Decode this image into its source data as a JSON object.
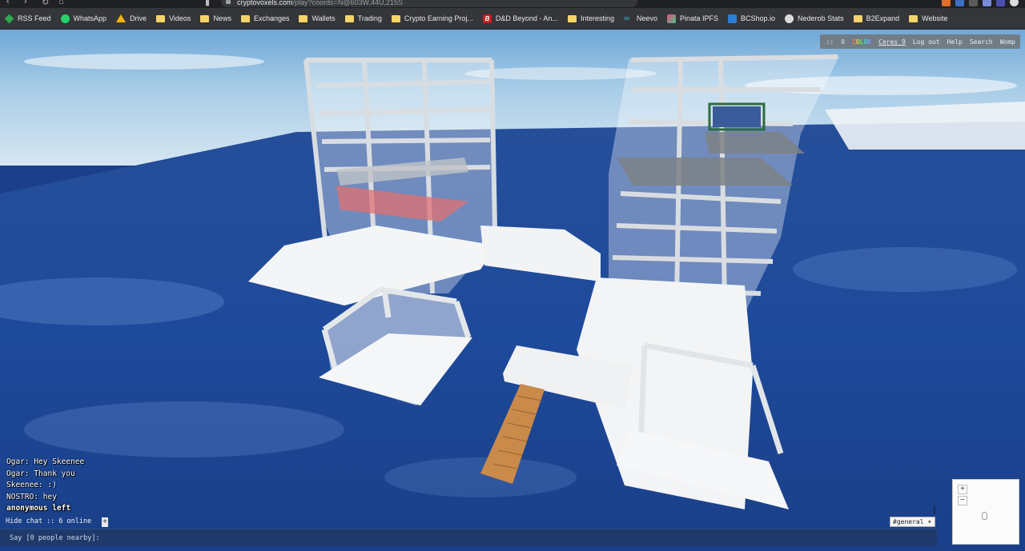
{
  "browser": {
    "url_host": "cryptovoxels.com",
    "url_path": "/play?coords=N@603W,44U,215S",
    "bookmarks": [
      {
        "label": "RSS Feed",
        "icon": "rss-icon"
      },
      {
        "label": "WhatsApp",
        "icon": "whatsapp-icon"
      },
      {
        "label": "Drive",
        "icon": "drive-icon"
      },
      {
        "label": "Videos",
        "icon": "folder-icon"
      },
      {
        "label": "News",
        "icon": "folder-icon"
      },
      {
        "label": "Exchanges",
        "icon": "folder-icon"
      },
      {
        "label": "Wallets",
        "icon": "folder-icon"
      },
      {
        "label": "Trading",
        "icon": "folder-icon"
      },
      {
        "label": "Crypto Earning Proj...",
        "icon": "folder-icon"
      },
      {
        "label": "D&D Beyond - An...",
        "icon": "dnd-icon"
      },
      {
        "label": "Interesting",
        "icon": "folder-icon"
      },
      {
        "label": "Neevo",
        "icon": "neevo-icon"
      },
      {
        "label": "Pinata IPFS",
        "icon": "pinata-icon"
      },
      {
        "label": "BCShop.io",
        "icon": "bcshop-icon"
      },
      {
        "label": "Nederob Stats",
        "icon": "globe-icon"
      },
      {
        "label": "B2Expand",
        "icon": "folder-icon"
      },
      {
        "label": "Website",
        "icon": "folder-icon"
      }
    ]
  },
  "hud": {
    "menu_glyph": "::",
    "coins": "0",
    "color_label": "COLOR",
    "username": "Ceres_9",
    "logout": "Log out",
    "help": "Help",
    "search": "Search",
    "womp": "Womp"
  },
  "chat": {
    "messages": [
      "Ogar: Hey Skeenee",
      "Ogar: Thank you",
      "Skeenee: :)",
      "NOSTRO: hey",
      "anonymous left"
    ],
    "hide_label": "Hide chat",
    "separator": "::",
    "online_label": "6 online",
    "expand_label": "+",
    "input_placeholder": "Say [0 people nearby]:",
    "channel": "#general",
    "channel_arrow": "▾"
  },
  "minimap": {
    "zoom_in": "+",
    "zoom_out": "−"
  },
  "colors": {
    "sky_top": "#7fb4dd",
    "ocean": "#1f4a9c",
    "accent_red": "#e07070",
    "deck_wood": "#c98a4a"
  }
}
